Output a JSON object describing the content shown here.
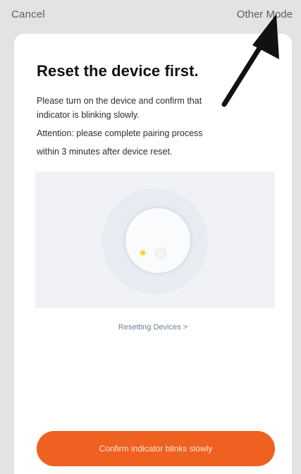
{
  "header": {
    "cancel_label": "Cancel",
    "other_mode_label": "Other Mode"
  },
  "card": {
    "title": "Reset the device first.",
    "description_lines": [
      "Please turn on the device and confirm that",
      "indicator is blinking slowly.",
      "Attention: please complete pairing process",
      "within 3 minutes after device reset."
    ],
    "resetting_link": "Resetting Devices >",
    "confirm_button": "Confirm indicator blinks slowly"
  },
  "colors": {
    "accent": "#ef6120",
    "led": "#f3d23a",
    "link": "#6b7f94"
  },
  "icons": {
    "overlay": "arrow-pointer-icon"
  }
}
